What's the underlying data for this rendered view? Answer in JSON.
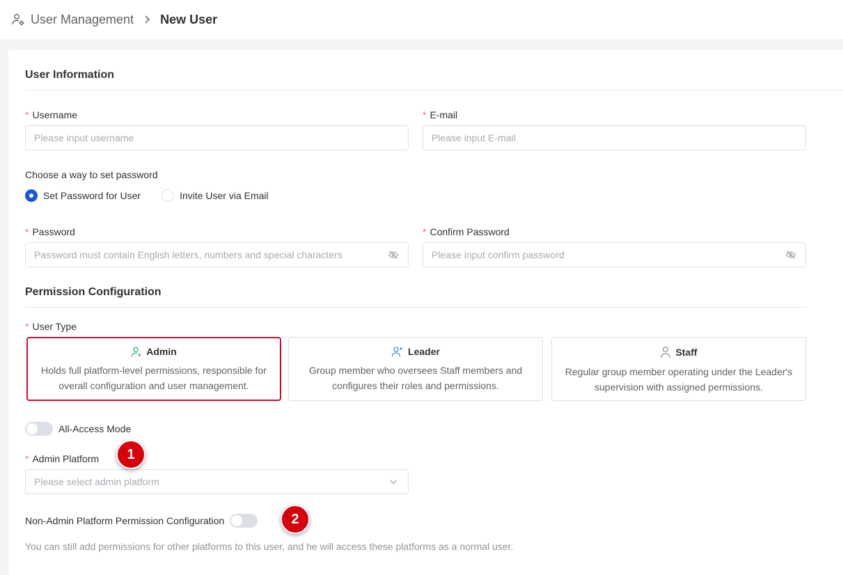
{
  "breadcrumb": {
    "icon": "user-settings-icon",
    "parent": "User Management",
    "current": "New User"
  },
  "user_info": {
    "title": "User Information",
    "username": {
      "label": "Username",
      "placeholder": "Please input username"
    },
    "email": {
      "label": "E-mail",
      "placeholder": "Please input E-mail"
    },
    "password_method": {
      "label": "Choose a way to set password",
      "options": [
        "Set Password for User",
        "Invite User via Email"
      ],
      "selected": "Set Password for User"
    },
    "password": {
      "label": "Password",
      "placeholder": "Password must contain English letters, numbers and special characters"
    },
    "confirm_password": {
      "label": "Confirm Password",
      "placeholder": "Please input confirm password"
    }
  },
  "permission": {
    "title": "Permission Configuration",
    "user_type_label": "User Type",
    "types": [
      {
        "name": "Admin",
        "icon": "admin-user-icon",
        "desc": "Holds full platform-level permissions, responsible for overall configuration and user management.",
        "selected": true
      },
      {
        "name": "Leader",
        "icon": "leader-user-icon",
        "desc": "Group member who oversees Staff members and configures their roles and permissions.",
        "selected": false
      },
      {
        "name": "Staff",
        "icon": "staff-user-icon",
        "desc": "Regular group member operating under the Leader's supervision with assigned permissions.",
        "selected": false
      }
    ],
    "all_access": {
      "label": "All-Access Mode",
      "on": false
    },
    "admin_platform": {
      "label": "Admin Platform",
      "placeholder": "Please select admin platform"
    },
    "non_admin": {
      "label": "Non-Admin Platform Permission Configuration",
      "on": false,
      "hint": "You can still add permissions for other platforms to this user, and he will access these platforms as a normal user."
    }
  },
  "markers": [
    "1",
    "2"
  ],
  "colors": {
    "primary": "#1a56db",
    "required": "#f56c6c",
    "selected_border": "#c8102e",
    "marker": "#d9000d",
    "admin_icon": "#2fb36b",
    "leader_icon": "#3a8ee6"
  }
}
